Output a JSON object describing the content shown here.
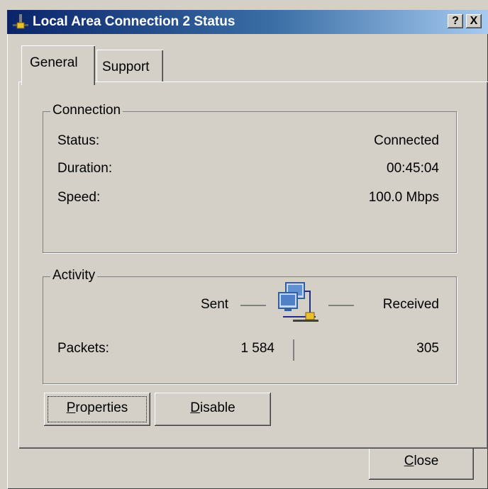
{
  "window": {
    "title": "Local Area Connection 2 Status",
    "help_label": "?",
    "close_label": "X"
  },
  "tabs": [
    {
      "label": "General",
      "active": true
    },
    {
      "label": "Support",
      "active": false
    }
  ],
  "connection": {
    "legend": "Connection",
    "rows": [
      {
        "label": "Status:",
        "value": "Connected"
      },
      {
        "label": "Duration:",
        "value": "00:45:04"
      },
      {
        "label": "Speed:",
        "value": "100.0 Mbps"
      }
    ]
  },
  "activity": {
    "legend": "Activity",
    "sent_label": "Sent",
    "received_label": "Received",
    "packets_label": "Packets:",
    "packets_sent": "1 584",
    "packets_received": "305",
    "icon": "network-connection-icon"
  },
  "buttons": {
    "properties": {
      "accel": "P",
      "rest": "roperties"
    },
    "disable": {
      "accel": "D",
      "rest": "isable"
    },
    "close": {
      "accel": "C",
      "rest": "lose"
    }
  },
  "colors": {
    "face": "#d4d0c8",
    "title_start": "#0a246a",
    "title_end": "#a6caf0"
  }
}
